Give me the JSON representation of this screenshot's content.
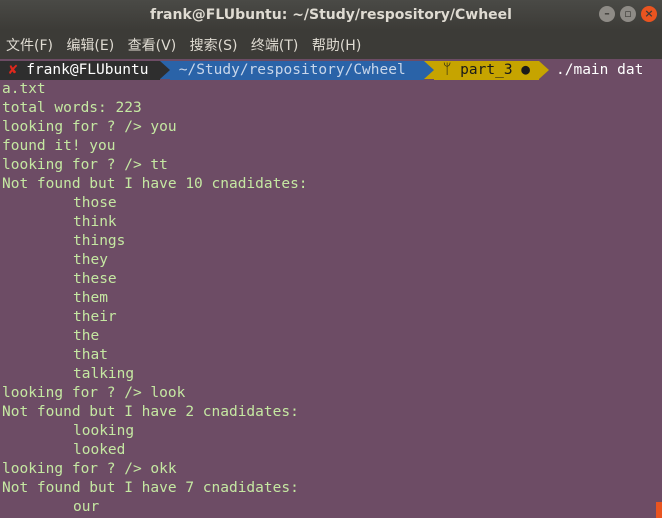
{
  "window": {
    "title": "frank@FLUbuntu: ~/Study/respository/Cwheel"
  },
  "menu": [
    "文件(F)",
    "编辑(E)",
    "查看(V)",
    "搜索(S)",
    "终端(T)",
    "帮助(H)"
  ],
  "prompt": {
    "status_mark": "✘",
    "user_host": "frank@FLUbuntu",
    "path": "~/Study/respository/Cwheel",
    "branch": "part_3",
    "branch_marker": "●",
    "command": "./main dat"
  },
  "output": [
    {
      "text": "a.txt",
      "indent": false
    },
    {
      "text": "total words: 223",
      "indent": false
    },
    {
      "text": "looking for ? /> you",
      "indent": false
    },
    {
      "text": "found it! you",
      "indent": false
    },
    {
      "text": "looking for ? /> tt",
      "indent": false
    },
    {
      "text": "Not found but I have 10 cnadidates:",
      "indent": false
    },
    {
      "text": "those",
      "indent": true
    },
    {
      "text": "think",
      "indent": true
    },
    {
      "text": "things",
      "indent": true
    },
    {
      "text": "they",
      "indent": true
    },
    {
      "text": "these",
      "indent": true
    },
    {
      "text": "them",
      "indent": true
    },
    {
      "text": "their",
      "indent": true
    },
    {
      "text": "the",
      "indent": true
    },
    {
      "text": "that",
      "indent": true
    },
    {
      "text": "talking",
      "indent": true
    },
    {
      "text": "looking for ? /> look",
      "indent": false
    },
    {
      "text": "Not found but I have 2 cnadidates:",
      "indent": false
    },
    {
      "text": "looking",
      "indent": true
    },
    {
      "text": "looked",
      "indent": true
    },
    {
      "text": "looking for ? /> okk",
      "indent": false
    },
    {
      "text": "Not found but I have 7 cnadidates:",
      "indent": false
    },
    {
      "text": "our",
      "indent": true
    }
  ]
}
